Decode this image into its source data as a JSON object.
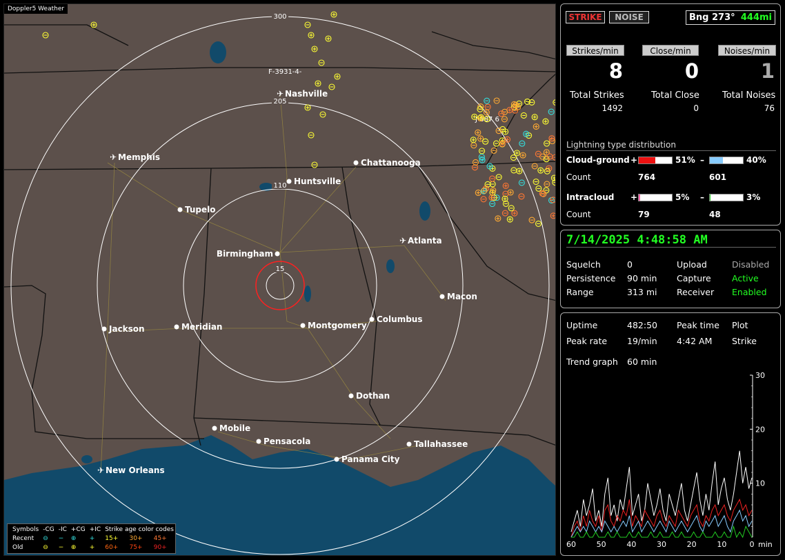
{
  "app": {
    "badge": "Doppler5 Weather"
  },
  "map": {
    "ring_labels": [
      "15",
      "110",
      "205",
      "300"
    ],
    "cities": [
      {
        "name": "Nashville",
        "icon": "airport"
      },
      {
        "name": "Memphis",
        "icon": "airport"
      },
      {
        "name": "Chattanooga",
        "icon": "dot"
      },
      {
        "name": "Huntsville",
        "icon": "dot"
      },
      {
        "name": "Tupelo",
        "icon": "dot"
      },
      {
        "name": "Birmingham",
        "icon": "dot"
      },
      {
        "name": "Atlanta",
        "icon": "airport"
      },
      {
        "name": "Macon",
        "icon": "dot"
      },
      {
        "name": "Jackson",
        "icon": "dot"
      },
      {
        "name": "Meridian",
        "icon": "dot"
      },
      {
        "name": "Montgomery",
        "icon": "dot"
      },
      {
        "name": "Columbus",
        "icon": "dot"
      },
      {
        "name": "Dothan",
        "icon": "dot"
      },
      {
        "name": "Mobile",
        "icon": "dot"
      },
      {
        "name": "Pensacola",
        "icon": "dot"
      },
      {
        "name": "Tallahassee",
        "icon": "dot"
      },
      {
        "name": "Panama City",
        "icon": "dot"
      },
      {
        "name": "New Orleans",
        "icon": "airport"
      }
    ],
    "storm_labels": [
      "F-3931-4-",
      "J-887 6"
    ],
    "legend": {
      "header": [
        "Symbols",
        "-CG",
        "-IC",
        "+CG",
        "+IC",
        "Strike age color codes"
      ],
      "recent": {
        "label": "Recent",
        "ages": [
          "15+",
          "30+",
          "45+"
        ]
      },
      "old": {
        "label": "Old",
        "ages": [
          "60+",
          "75+",
          "90+"
        ]
      },
      "age_colors": [
        "#ffff33",
        "#ffaa33",
        "#ff7733",
        "#ff6611",
        "#ff4411",
        "#ee2222"
      ]
    },
    "colors": {
      "land": "#5c504b",
      "water": "#114a6a",
      "range_ring": "#ffffff",
      "close_ring": "#ff2020"
    }
  },
  "strike_panel": {
    "strike_button": "STRIKE",
    "noise_button": "NOISE",
    "bearing": "Bng 273°",
    "distance": "444mi",
    "rates": [
      {
        "label": "Strikes/min",
        "value": "8"
      },
      {
        "label": "Close/min",
        "value": "0"
      },
      {
        "label": "Noises/min",
        "value": "1"
      }
    ],
    "totals": [
      {
        "label": "Total Strikes",
        "value": "1492"
      },
      {
        "label": "Total Close",
        "value": "0"
      },
      {
        "label": "Total Noises",
        "value": "76"
      }
    ],
    "distribution_title": "Lightning type distribution",
    "cloud_ground": {
      "label": "Cloud-ground",
      "count_label": "Count",
      "pos_sign": "+",
      "neg_sign": "–",
      "pos_pct": "51%",
      "neg_pct": "40%",
      "pos_fraction": 0.51,
      "neg_fraction": 0.4,
      "pos_count": "764",
      "neg_count": "601",
      "pos_color": "#ee1111",
      "neg_color": "#88ccff"
    },
    "intracloud": {
      "label": "Intracloud",
      "count_label": "Count",
      "pos_sign": "+",
      "neg_sign": "–",
      "pos_pct": "5%",
      "neg_pct": "3%",
      "pos_fraction": 0.05,
      "neg_fraction": 0.03,
      "pos_count": "79",
      "neg_count": "48",
      "pos_color": "#ff66aa",
      "neg_color": "#22cc22"
    }
  },
  "status_panel": {
    "datetime": "7/14/2025 4:48:58 AM",
    "squelch_label": "Squelch",
    "squelch": "0",
    "persistence_label": "Persistence",
    "persistence": "90 min",
    "range_label": "Range",
    "range": "313 mi",
    "upload_label": "Upload",
    "upload": "Disabled",
    "capture_label": "Capture",
    "capture": "Active",
    "receiver_label": "Receiver",
    "receiver": "Enabled"
  },
  "trend_panel": {
    "uptime_label": "Uptime",
    "uptime": "482:50",
    "peak_rate_label": "Peak rate",
    "peak_rate": "19/min",
    "peak_time_label": "Peak time",
    "peak_time": "4:42 AM",
    "plot_label": "Plot",
    "plot": "Strike",
    "trend_label": "Trend graph",
    "trend_window": "60 min",
    "chart_data": {
      "type": "line",
      "x_labels": [
        "60",
        "50",
        "40",
        "30",
        "20",
        "10",
        "0"
      ],
      "x_unit": "min",
      "y_ticks": [
        "30",
        "20",
        "10"
      ],
      "ylim": [
        0,
        30
      ],
      "series_colors": [
        "#ffffff",
        "#ee2222",
        "#88ccff",
        "#22cc22"
      ],
      "series": [
        {
          "values": [
            1,
            3,
            5,
            2,
            7,
            4,
            6,
            9,
            3,
            5,
            2,
            8,
            11,
            4,
            6,
            3,
            7,
            5,
            9,
            13,
            4,
            6,
            8,
            3,
            5,
            10,
            7,
            4,
            6,
            9,
            5,
            3,
            8,
            6,
            4,
            7,
            10,
            5,
            3,
            6,
            9,
            12,
            7,
            4,
            8,
            5,
            10,
            14,
            6,
            9,
            11,
            7,
            5,
            8,
            12,
            16,
            10,
            13,
            9,
            11
          ]
        },
        {
          "values": [
            0,
            2,
            3,
            1,
            4,
            2,
            5,
            3,
            2,
            4,
            1,
            5,
            6,
            3,
            2,
            4,
            3,
            5,
            4,
            7,
            2,
            4,
            3,
            2,
            5,
            4,
            3,
            2,
            4,
            5,
            3,
            2,
            4,
            3,
            2,
            5,
            4,
            3,
            2,
            4,
            5,
            6,
            3,
            2,
            4,
            3,
            5,
            6,
            4,
            5,
            6,
            4,
            3,
            5,
            6,
            7,
            5,
            6,
            4,
            5
          ]
        },
        {
          "values": [
            0,
            1,
            2,
            1,
            2,
            1,
            3,
            2,
            1,
            2,
            1,
            3,
            2,
            1,
            2,
            1,
            2,
            3,
            2,
            4,
            1,
            2,
            3,
            1,
            2,
            3,
            2,
            1,
            2,
            3,
            2,
            1,
            3,
            2,
            1,
            2,
            3,
            2,
            1,
            2,
            3,
            4,
            2,
            1,
            3,
            2,
            3,
            4,
            2,
            3,
            4,
            2,
            1,
            3,
            4,
            5,
            3,
            4,
            2,
            3
          ]
        },
        {
          "values": [
            0,
            0,
            1,
            0,
            0,
            1,
            0,
            0,
            1,
            0,
            0,
            0,
            1,
            0,
            0,
            1,
            0,
            0,
            0,
            1,
            0,
            0,
            1,
            0,
            0,
            0,
            1,
            0,
            0,
            1,
            0,
            0,
            0,
            1,
            0,
            0,
            1,
            0,
            0,
            0,
            1,
            0,
            0,
            1,
            0,
            0,
            0,
            1,
            0,
            0,
            1,
            0,
            0,
            2,
            0,
            1,
            0,
            2,
            1,
            0
          ]
        }
      ]
    }
  }
}
